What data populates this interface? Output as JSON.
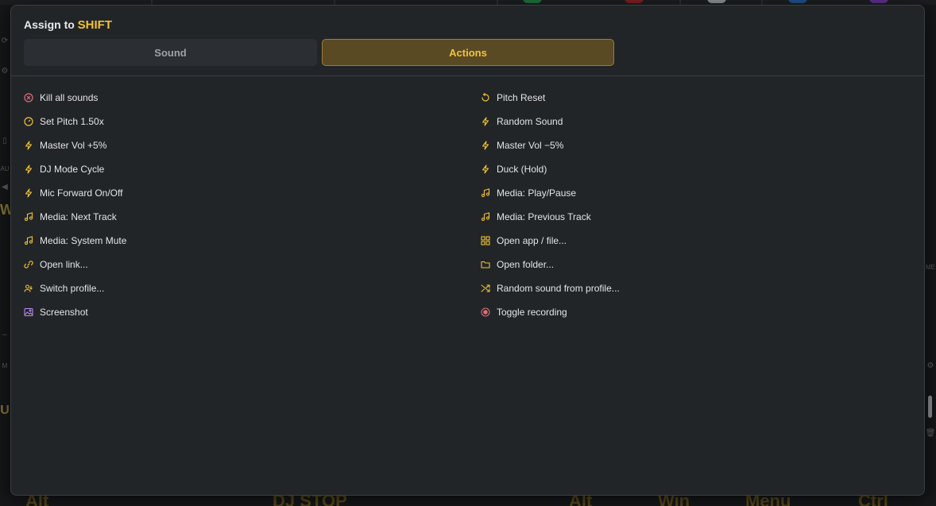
{
  "modal": {
    "title_prefix": "Assign to",
    "key_name": "SHIFT",
    "tabs": [
      {
        "label": "Sound",
        "active": false
      },
      {
        "label": "Actions",
        "active": true
      }
    ]
  },
  "actions_left": [
    {
      "label": "Kill all sounds",
      "icon": "kill-icon",
      "color": "#e06c7a"
    },
    {
      "label": "Set Pitch 1.50x",
      "icon": "gauge-icon",
      "color": "#f1c232"
    },
    {
      "label": "Master Vol +5%",
      "icon": "bolt-icon",
      "color": "#f1c232"
    },
    {
      "label": "DJ Mode Cycle",
      "icon": "bolt-icon",
      "color": "#f1c232"
    },
    {
      "label": "Mic Forward On/Off",
      "icon": "bolt-icon",
      "color": "#f1c232"
    },
    {
      "label": "Media: Next Track",
      "icon": "music-note-icon",
      "color": "#f1c232"
    },
    {
      "label": "Media: System Mute",
      "icon": "music-note-icon",
      "color": "#f1c232"
    },
    {
      "label": "Open link...",
      "icon": "link-icon",
      "color": "#f1c232"
    },
    {
      "label": "Switch profile...",
      "icon": "user-switch-icon",
      "color": "#f1c232"
    },
    {
      "label": "Screenshot",
      "icon": "image-icon",
      "color": "#b58cf0"
    }
  ],
  "actions_right": [
    {
      "label": "Pitch Reset",
      "icon": "rotate-icon",
      "color": "#f1c232"
    },
    {
      "label": "Random Sound",
      "icon": "bolt-icon",
      "color": "#f1c232"
    },
    {
      "label": "Master Vol −5%",
      "icon": "bolt-icon",
      "color": "#f1c232"
    },
    {
      "label": "Duck (Hold)",
      "icon": "bolt-icon",
      "color": "#f1c232"
    },
    {
      "label": "Media: Play/Pause",
      "icon": "music-note-icon",
      "color": "#f1c232"
    },
    {
      "label": "Media: Previous Track",
      "icon": "music-note-icon",
      "color": "#f1c232"
    },
    {
      "label": "Open app / file...",
      "icon": "grid-icon",
      "color": "#f1c232"
    },
    {
      "label": "Open folder...",
      "icon": "folder-icon",
      "color": "#f1c232"
    },
    {
      "label": "Random sound from profile...",
      "icon": "shuffle-icon",
      "color": "#f1c232"
    },
    {
      "label": "Toggle recording",
      "icon": "record-icon",
      "color": "#e06c7a"
    }
  ],
  "background": {
    "bottom_keys": [
      "Alt",
      "DJ STOP",
      "Alt",
      "Win",
      "Menu",
      "Ctrl"
    ],
    "left_glyphs": [
      "⟳",
      "⚙",
      "▯",
      "AU",
      "◀",
      "W",
      "–",
      "M",
      "U"
    ],
    "right_glyphs": [
      "ME",
      "⚙",
      "🗑"
    ]
  }
}
